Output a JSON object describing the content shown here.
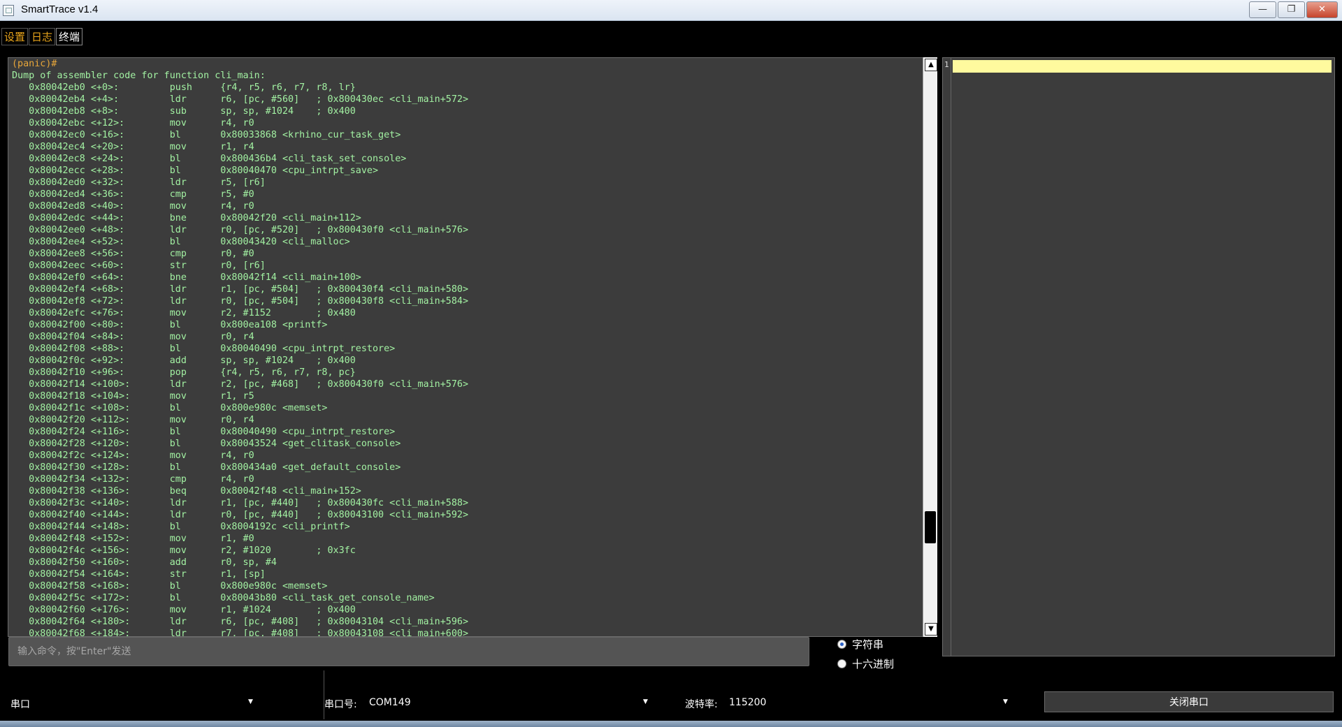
{
  "window": {
    "title": "SmartTrace v1.4",
    "minimize": "—",
    "restore": "❐",
    "close": "✕"
  },
  "tabs": [
    {
      "label": "设置"
    },
    {
      "label": "日志"
    },
    {
      "label": "终端"
    }
  ],
  "terminal": {
    "prompt": "(panic)#",
    "lines": [
      "Dump of assembler code for function cli_main:",
      "   0x80042eb0 <+0>:\tpush\t{r4, r5, r6, r7, r8, lr}",
      "   0x80042eb4 <+4>:\tldr\tr6, [pc, #560]\t; 0x800430ec <cli_main+572>",
      "   0x80042eb8 <+8>:\tsub\tsp, sp, #1024\t; 0x400",
      "   0x80042ebc <+12>:\tmov\tr4, r0",
      "   0x80042ec0 <+16>:\tbl\t0x80033868 <krhino_cur_task_get>",
      "   0x80042ec4 <+20>:\tmov\tr1, r4",
      "   0x80042ec8 <+24>:\tbl\t0x800436b4 <cli_task_set_console>",
      "   0x80042ecc <+28>:\tbl\t0x80040470 <cpu_intrpt_save>",
      "   0x80042ed0 <+32>:\tldr\tr5, [r6]",
      "   0x80042ed4 <+36>:\tcmp\tr5, #0",
      "   0x80042ed8 <+40>:\tmov\tr4, r0",
      "   0x80042edc <+44>:\tbne\t0x80042f20 <cli_main+112>",
      "   0x80042ee0 <+48>:\tldr\tr0, [pc, #520]\t; 0x800430f0 <cli_main+576>",
      "   0x80042ee4 <+52>:\tbl\t0x80043420 <cli_malloc>",
      "   0x80042ee8 <+56>:\tcmp\tr0, #0",
      "   0x80042eec <+60>:\tstr\tr0, [r6]",
      "   0x80042ef0 <+64>:\tbne\t0x80042f14 <cli_main+100>",
      "   0x80042ef4 <+68>:\tldr\tr1, [pc, #504]\t; 0x800430f4 <cli_main+580>",
      "   0x80042ef8 <+72>:\tldr\tr0, [pc, #504]\t; 0x800430f8 <cli_main+584>",
      "   0x80042efc <+76>:\tmov\tr2, #1152\t; 0x480",
      "   0x80042f00 <+80>:\tbl\t0x800ea108 <printf>",
      "   0x80042f04 <+84>:\tmov\tr0, r4",
      "   0x80042f08 <+88>:\tbl\t0x80040490 <cpu_intrpt_restore>",
      "   0x80042f0c <+92>:\tadd\tsp, sp, #1024\t; 0x400",
      "   0x80042f10 <+96>:\tpop\t{r4, r5, r6, r7, r8, pc}",
      "   0x80042f14 <+100>:\tldr\tr2, [pc, #468]\t; 0x800430f0 <cli_main+576>",
      "   0x80042f18 <+104>:\tmov\tr1, r5",
      "   0x80042f1c <+108>:\tbl\t0x800e980c <memset>",
      "   0x80042f20 <+112>:\tmov\tr0, r4",
      "   0x80042f24 <+116>:\tbl\t0x80040490 <cpu_intrpt_restore>",
      "   0x80042f28 <+120>:\tbl\t0x80043524 <get_clitask_console>",
      "   0x80042f2c <+124>:\tmov\tr4, r0",
      "   0x80042f30 <+128>:\tbl\t0x800434a0 <get_default_console>",
      "   0x80042f34 <+132>:\tcmp\tr4, r0",
      "   0x80042f38 <+136>:\tbeq\t0x80042f48 <cli_main+152>",
      "   0x80042f3c <+140>:\tldr\tr1, [pc, #440]\t; 0x800430fc <cli_main+588>",
      "   0x80042f40 <+144>:\tldr\tr0, [pc, #440]\t; 0x80043100 <cli_main+592>",
      "   0x80042f44 <+148>:\tbl\t0x8004192c <cli_printf>",
      "   0x80042f48 <+152>:\tmov\tr1, #0",
      "   0x80042f4c <+156>:\tmov\tr2, #1020\t; 0x3fc",
      "   0x80042f50 <+160>:\tadd\tr0, sp, #4",
      "   0x80042f54 <+164>:\tstr\tr1, [sp]",
      "   0x80042f58 <+168>:\tbl\t0x800e980c <memset>",
      "   0x80042f5c <+172>:\tbl\t0x80043b80 <cli_task_get_console_name>",
      "   0x80042f60 <+176>:\tmov\tr1, #1024\t; 0x400",
      "   0x80042f64 <+180>:\tldr\tr6, [pc, #408]\t; 0x80043104 <cli_main+596>",
      "   0x80042f68 <+184>:\tldr\tr7, [pc, #408]\t; 0x80043108 <cli_main+600>"
    ]
  },
  "editor": {
    "line_number": "1"
  },
  "command": {
    "placeholder": "输入命令，按\"Enter\"发送"
  },
  "mode": {
    "string_label": "字符串",
    "hex_label": "十六进制",
    "selected": "string"
  },
  "bottom": {
    "port_type_label": "串口",
    "port_number_label": "串口号:",
    "port_number_value": "COM149",
    "baud_label": "波特率:",
    "baud_value": "115200",
    "close_port_label": "关闭串口"
  }
}
